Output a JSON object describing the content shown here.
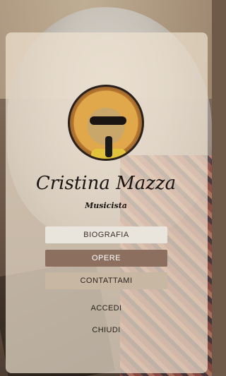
{
  "profile": {
    "name": "Cristina Mazza",
    "role": "Musicista"
  },
  "menu": {
    "items": [
      {
        "label": "BIOGRAFIA",
        "active": false
      },
      {
        "label": "OPERE",
        "active": true
      },
      {
        "label": "CONTATTAMI",
        "active": false
      }
    ],
    "login_label": "ACCEDI",
    "close_label": "CHIUDI"
  },
  "colors": {
    "accent": "#8c6f5f",
    "card_overlay": "#eee2d0"
  }
}
